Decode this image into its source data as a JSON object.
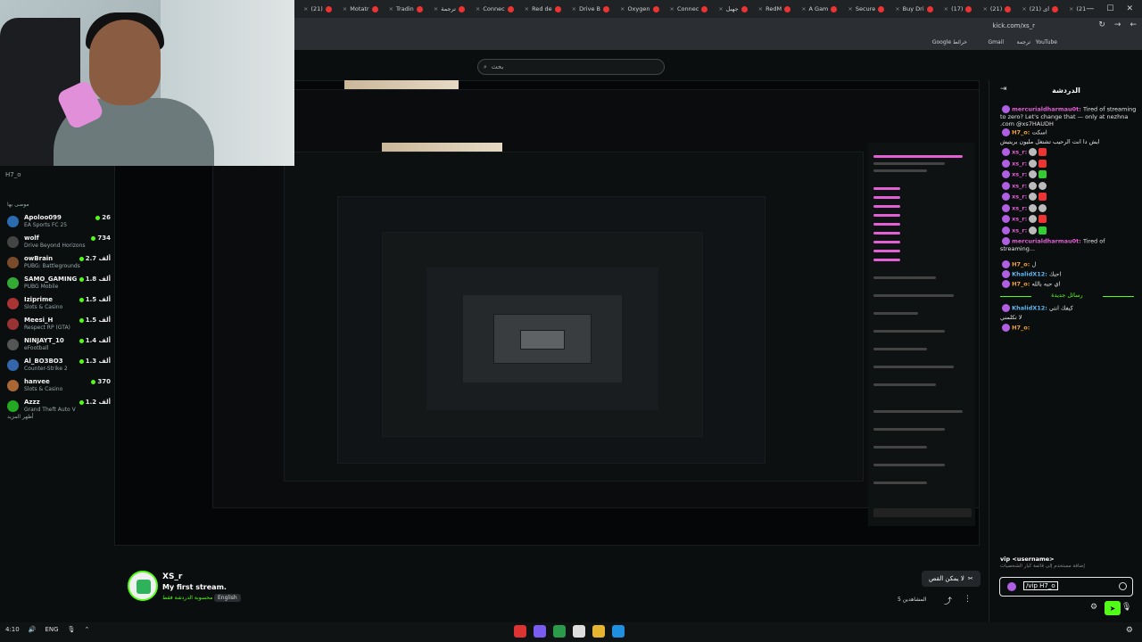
{
  "browser": {
    "tabs": [
      {
        "label": "(21)",
        "icon": "youtube-icon"
      },
      {
        "label": "Motatr",
        "icon": "youtube-icon"
      },
      {
        "label": "Tradin",
        "icon": "youtube-icon"
      },
      {
        "label": "ترجمة",
        "icon": "youtube-icon"
      },
      {
        "label": "Connec",
        "icon": "youtube-icon"
      },
      {
        "label": "Red de",
        "icon": "youtube-icon"
      },
      {
        "label": "Drive B",
        "icon": "youtube-icon"
      },
      {
        "label": "Oxygen",
        "icon": "youtube-icon"
      },
      {
        "label": "Connec",
        "icon": "youtube-icon"
      },
      {
        "label": "جهبل",
        "icon": "youtube-icon"
      },
      {
        "label": "RedM",
        "icon": "youtube-icon"
      },
      {
        "label": "A Gam",
        "icon": "youtube-icon"
      },
      {
        "label": "Secure",
        "icon": "youtube-icon"
      },
      {
        "label": "Buy Dri",
        "icon": "youtube-icon"
      },
      {
        "label": "(17)",
        "icon": "youtube-icon"
      },
      {
        "label": "(21)",
        "icon": "youtube-icon"
      },
      {
        "label": "(21) ای",
        "icon": "youtube-icon"
      },
      {
        "label": "(21) ای",
        "icon": "youtube-icon"
      },
      {
        "label": "(21) TH",
        "icon": "youtube-icon"
      },
      {
        "label": "(21) ده",
        "icon": "youtube-icon"
      }
    ],
    "url": "kick.com/xs_r",
    "bookmarks": [
      "Google خرائط",
      "Gmail",
      "ترجمة",
      "YouTube"
    ]
  },
  "search": {
    "placeholder": "بحث"
  },
  "sidebar": {
    "title": "H7_o",
    "subtitle": "موصى بها",
    "more_label": "أظهر المزيد",
    "items": [
      {
        "name": "Apoloo099",
        "game": "EA Sports FC 25",
        "count": "26",
        "avatar_color": "#2b6cb0"
      },
      {
        "name": "wolf",
        "game": "Drive Beyond Horizons",
        "count": "734",
        "avatar_color": "#444"
      },
      {
        "name": "owBrain",
        "game": "PUBG: Battlegrounds",
        "count": "2.7 ألف",
        "avatar_color": "#7a4b2a"
      },
      {
        "name": "SAMO_GAMING",
        "game": "PUBG Mobile",
        "count": "1.8 ألف",
        "avatar_color": "#3a3"
      },
      {
        "name": "Iziprime",
        "game": "Slots & Casino",
        "count": "1.5 ألف",
        "avatar_color": "#a33"
      },
      {
        "name": "Meesi_H",
        "game": "Respect RP (GTA)",
        "count": "1.5 ألف",
        "avatar_color": "#933"
      },
      {
        "name": "NINJAYT_10",
        "game": "eFootball",
        "count": "1.4 ألف",
        "avatar_color": "#555"
      },
      {
        "name": "Al_BO3BO3",
        "game": "Counter-Strike 2",
        "count": "1.3 ألف",
        "avatar_color": "#36a"
      },
      {
        "name": "hanvee",
        "game": "Slots & Casino",
        "count": "370",
        "avatar_color": "#a63"
      },
      {
        "name": "Azzz",
        "game": "Grand Theft Auto V",
        "count": "1.2 ألف",
        "avatar_color": "#2a2"
      }
    ]
  },
  "stream": {
    "channel": "XS_r",
    "title": "My first stream.",
    "category": "محسوبة الدردشة فقط",
    "language": "English",
    "clip_label": "لا يمكن القص",
    "viewers_label": "المشاهدين 5"
  },
  "chat": {
    "title": "الدردشة",
    "messages": [
      {
        "user": "mercurialdharmau0t:",
        "text": " Tired of streaming to zero? Let's change that — only at nezhna .com @xs7HAUDH",
        "style": "pink"
      },
      {
        "user": "H7_o:",
        "text": " اسكت",
        "style": "orange"
      },
      {
        "user": "",
        "text": "ايش دا انت الرحيب تشتغل مليون بريتيش",
        "style": "plain"
      },
      {
        "user": "xs_r:",
        "text": "",
        "style": "pink",
        "badges": [
          "b-gray",
          "b-red"
        ]
      },
      {
        "user": "xs_r:",
        "text": "",
        "style": "pink",
        "badges": [
          "b-gray",
          "b-red"
        ]
      },
      {
        "user": "xs_r:",
        "text": "",
        "style": "pink",
        "badges": [
          "b-gray",
          "b-green"
        ]
      },
      {
        "user": "xs_r:",
        "text": "",
        "style": "pink",
        "badges": [
          "b-gray",
          "b-gray"
        ]
      },
      {
        "user": "xs_r:",
        "text": "",
        "style": "pink",
        "badges": [
          "b-gray",
          "b-red"
        ]
      },
      {
        "user": "xs_r:",
        "text": "",
        "style": "pink",
        "badges": [
          "b-gray",
          "b-gray"
        ]
      },
      {
        "user": "xs_r:",
        "text": "",
        "style": "pink",
        "badges": [
          "b-gray",
          "b-red"
        ]
      },
      {
        "user": "xs_r:",
        "text": "",
        "style": "pink",
        "badges": [
          "b-gray",
          "b-green"
        ]
      },
      {
        "user": "mercurialdharmau0t:",
        "text": " Tired of streaming...",
        "style": "pink"
      },
      {
        "user": "H7_o:",
        "text": " ل",
        "style": "orange"
      },
      {
        "user": "KhalidX12:",
        "text": " احبك",
        "style": "blue"
      },
      {
        "user": "H7_o:",
        "text": " اي حبه بالله",
        "style": "orange"
      }
    ],
    "new_messages_label": "رسائل جديدة",
    "late_messages": [
      {
        "user": "KhalidX12:",
        "text": " كيفك انتي",
        "style": "blue"
      },
      {
        "user": "",
        "text": "لا تكلمني",
        "style": "plain"
      },
      {
        "user": "H7_o:",
        "text": "",
        "style": "orange"
      }
    ],
    "command_hint": "vip <username>",
    "command_desc": "إضافة مستخدم إلى قائمة كبار الشخصيات",
    "input_value": "/vip H7_o",
    "send_label": "دردشة"
  },
  "taskbar": {
    "time": "4:10",
    "lang": "ENG"
  }
}
